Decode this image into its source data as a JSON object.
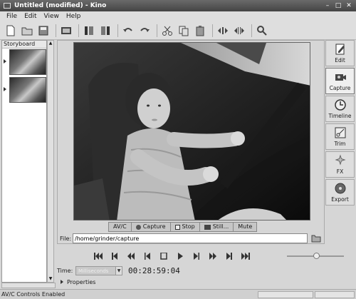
{
  "window": {
    "title": "Untitled (modified) - Kino",
    "controls": [
      "minimize",
      "maximize",
      "close"
    ]
  },
  "menu": {
    "items": [
      "File",
      "Edit",
      "View",
      "Help"
    ]
  },
  "toolbar": {
    "icons": [
      "new-file",
      "open-file",
      "save-file",
      "export-film",
      "trim-clip-start",
      "trim-clip-end",
      "undo",
      "redo",
      "cut",
      "copy",
      "paste",
      "split-left",
      "split-right",
      "zoom-find"
    ]
  },
  "storyboard": {
    "title": "Storyboard",
    "items_count": 2
  },
  "capture_tabs": [
    "AV/C",
    "Capture",
    "Stop",
    "Still...",
    "Mute"
  ],
  "file": {
    "label": "File:",
    "path": "/home/grinder/capture"
  },
  "sidebar": {
    "items": [
      {
        "label": "Edit",
        "icon": "edit-icon"
      },
      {
        "label": "Capture",
        "icon": "capture-icon"
      },
      {
        "label": "Timeline",
        "icon": "timeline-icon"
      },
      {
        "label": "Trim",
        "icon": "trim-icon"
      },
      {
        "label": "FX",
        "icon": "fx-icon"
      },
      {
        "label": "Export",
        "icon": "export-icon"
      }
    ],
    "active": "Capture"
  },
  "transport": [
    "start",
    "prev-scene",
    "rewind",
    "back-frame",
    "stop",
    "play",
    "forward-frame",
    "fast-forward",
    "next-scene",
    "end"
  ],
  "time": {
    "label": "Time:",
    "format": "Milliseconds",
    "value": "00:28:59:04"
  },
  "properties": {
    "label": "Properties"
  },
  "status": {
    "text": "AV/C Controls Enabled"
  }
}
